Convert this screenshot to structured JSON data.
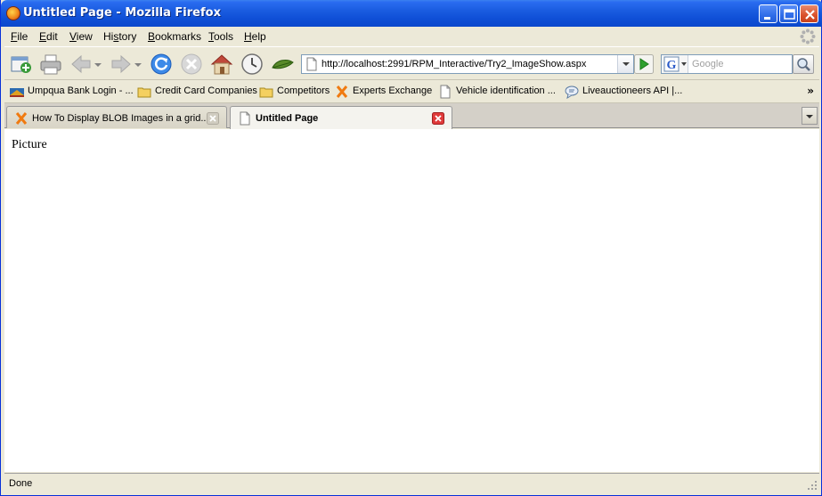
{
  "window": {
    "title": "Untitled Page - Mozilla Firefox"
  },
  "menu": [
    {
      "key": "F",
      "rest": "ile"
    },
    {
      "key": "E",
      "rest": "dit"
    },
    {
      "key": "V",
      "rest": "iew"
    },
    {
      "key": "H",
      "pre": "",
      "rest": "istory",
      "label_full": "History",
      "uidx": 1
    },
    {
      "key": "B",
      "rest": "ookmarks"
    },
    {
      "key": "T",
      "rest": "ools"
    },
    {
      "key": "H",
      "rest": "elp"
    }
  ],
  "menu_labels": {
    "file_u": "F",
    "file_r": "ile",
    "edit_u": "E",
    "edit_r": "dit",
    "view_u": "V",
    "view_r": "iew",
    "history_a": "Hi",
    "history_u": "s",
    "history_r": "tory",
    "bookmarks_u": "B",
    "bookmarks_r": "ookmarks",
    "tools_u": "T",
    "tools_r": "ools",
    "help_u": "H",
    "help_r": "elp"
  },
  "navigation": {
    "url": "http://localhost:2991/RPM_Interactive/Try2_ImageShow.aspx",
    "search_placeholder": "Google",
    "search_engine_icon": "google-icon"
  },
  "bookmarks": [
    {
      "label": "Umpqua Bank Login - ...",
      "icon": "bank-icon"
    },
    {
      "label": "Credit Card Companies",
      "icon": "folder-icon"
    },
    {
      "label": "Competitors",
      "icon": "folder-icon"
    },
    {
      "label": "Experts Exchange",
      "icon": "experts-exchange-icon"
    },
    {
      "label": "Vehicle identification ...",
      "icon": "page-icon"
    },
    {
      "label": "Liveauctioneers API |...",
      "icon": "chat-bubble-icon"
    }
  ],
  "tabs": [
    {
      "label": "How To Display BLOB Images in a grid...",
      "active": false,
      "icon": "experts-exchange-icon"
    },
    {
      "label": "Untitled Page",
      "active": true,
      "icon": "page-icon"
    }
  ],
  "page": {
    "text": "Picture"
  },
  "status": {
    "text": "Done"
  },
  "colors": {
    "titlebar": "#0b48cc",
    "close_button": "#d9502a",
    "tab_close_active": "#e03a3a",
    "go_arrow": "#2ea02e",
    "reload": "#2a7ae0"
  }
}
